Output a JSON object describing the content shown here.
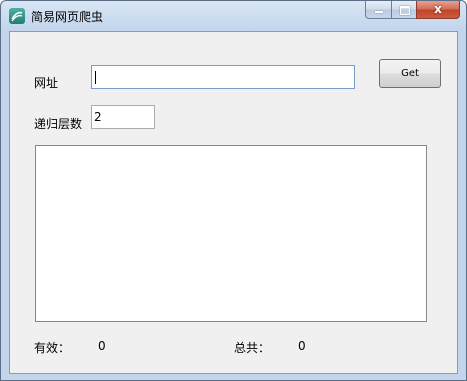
{
  "window": {
    "title": "简易网页爬虫",
    "close_glyph": "x"
  },
  "form": {
    "url_label": "网址",
    "url_value": "",
    "get_button": "Get",
    "depth_label": "递归层数",
    "depth_value": "2"
  },
  "status": {
    "valid_label": "有效：",
    "valid_count": "0",
    "total_label": "总共：",
    "total_count": "0"
  }
}
